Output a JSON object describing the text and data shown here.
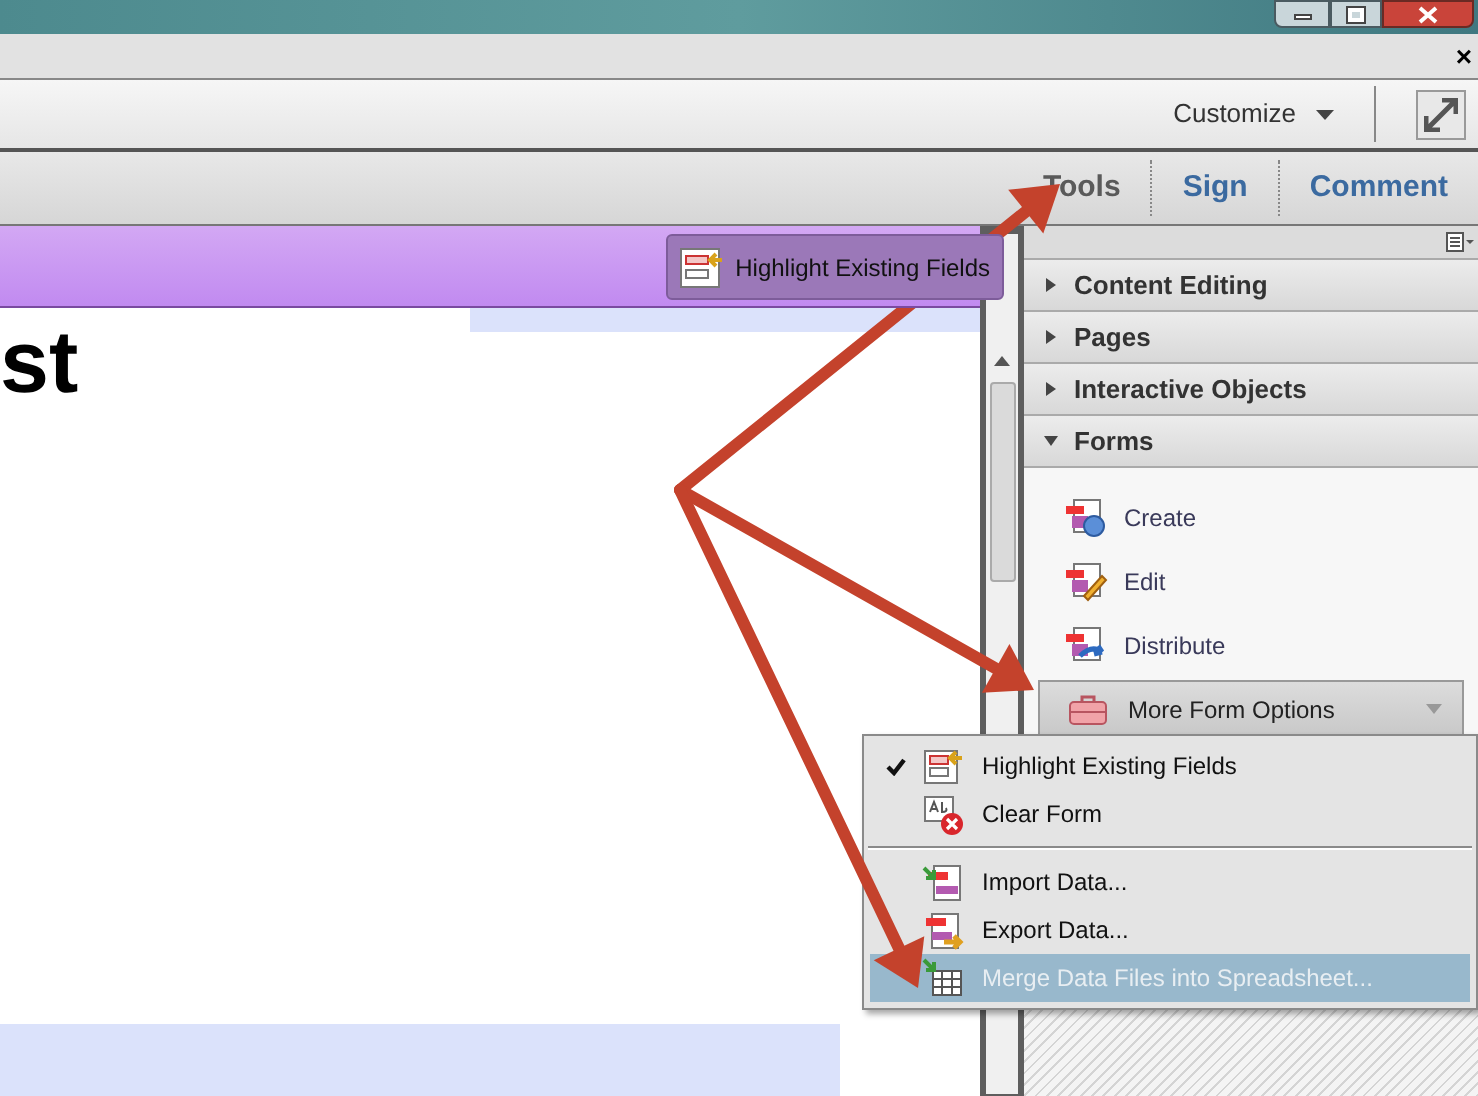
{
  "document_bar": {
    "close": "×"
  },
  "toolbar": {
    "customize": "Customize"
  },
  "tabs": [
    {
      "label": "Tools",
      "selected": true
    },
    {
      "label": "Sign",
      "selected": false
    },
    {
      "label": "Comment",
      "selected": false
    }
  ],
  "forms_bar": {
    "button": "Highlight Existing Fields"
  },
  "document": {
    "heading": "st"
  },
  "panel": {
    "sections": [
      {
        "label": "Content Editing",
        "expanded": false
      },
      {
        "label": "Pages",
        "expanded": false
      },
      {
        "label": "Interactive Objects",
        "expanded": false
      },
      {
        "label": "Forms",
        "expanded": true,
        "items": [
          "Create",
          "Edit",
          "Distribute"
        ],
        "more": "More Form Options"
      }
    ]
  },
  "menu": {
    "groups": [
      [
        {
          "label": "Highlight Existing Fields",
          "checked": true,
          "selected": false,
          "disabled": false
        },
        {
          "label": "Clear Form",
          "checked": false,
          "selected": false,
          "disabled": false
        }
      ],
      [
        {
          "label": "Import Data...",
          "checked": false,
          "selected": false,
          "disabled": false
        },
        {
          "label": "Export Data...",
          "checked": false,
          "selected": false,
          "disabled": false
        },
        {
          "label": "Merge Data Files into Spreadsheet...",
          "checked": false,
          "selected": true,
          "disabled": true
        }
      ]
    ]
  }
}
